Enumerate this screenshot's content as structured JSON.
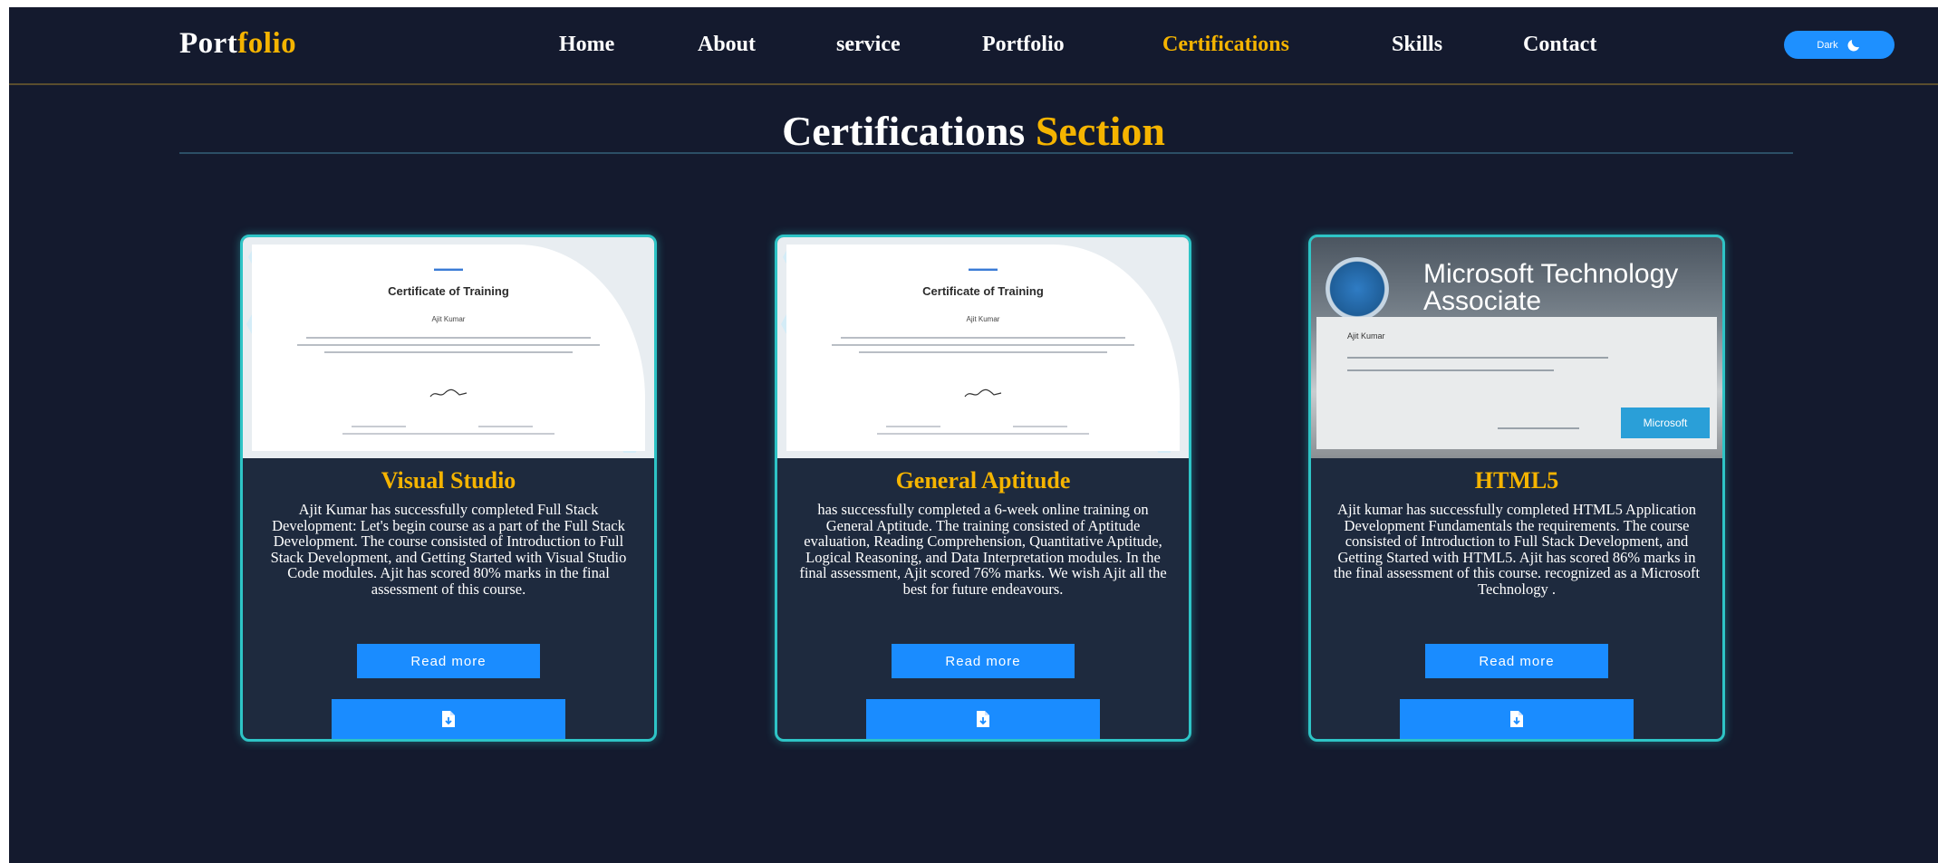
{
  "nav": {
    "logo_main": "Port",
    "logo_accent": "folio",
    "links": [
      {
        "label": "Home",
        "active": false
      },
      {
        "label": "About",
        "active": false
      },
      {
        "label": "service",
        "active": false
      },
      {
        "label": "Portfolio",
        "active": false
      },
      {
        "label": "Certifications",
        "active": true
      },
      {
        "label": "Skills",
        "active": false
      },
      {
        "label": "Contact",
        "active": false
      }
    ],
    "theme_toggle_label": "Dark",
    "theme_toggle_icon": "moon-icon"
  },
  "section": {
    "title_main": "Certifications",
    "title_accent": "Section"
  },
  "colors": {
    "accent": "#f5b400",
    "background": "#141a2e",
    "card_bg": "#1e2a3e",
    "card_border": "#2ec4c6",
    "button": "#1a8cff"
  },
  "cards": [
    {
      "title": "Visual Studio",
      "description": "Ajit Kumar has successfully completed Full Stack Development: Let's begin course as a part of the Full Stack Development. The course consisted of Introduction to Full Stack Development, and Getting Started with Visual Studio Code modules. Ajit has scored 80% marks in the final assessment of this course.",
      "read_more": "Read more",
      "certificate": {
        "heading": "Certificate of Training",
        "name": "Ajit Kumar"
      },
      "download_icon": "file-download-icon"
    },
    {
      "title": "General Aptitude",
      "description": "has successfully completed a 6-week online training on General Aptitude. The training consisted of Aptitude evaluation, Reading Comprehension, Quantitative Aptitude, Logical Reasoning, and Data Interpretation modules. In the final assessment, Ajit scored 76% marks. We wish Ajit all the best for future endeavours.",
      "read_more": "Read more",
      "certificate": {
        "heading": "Certificate of Training",
        "name": "Ajit Kumar"
      },
      "download_icon": "file-download-icon"
    },
    {
      "title": "HTML5",
      "description": "Ajit kumar has successfully completed HTML5 Application Development Fundamentals the requirements. The course consisted of Introduction to Full Stack Development, and Getting Started with HTML5. Ajit has scored 86% marks in the final assessment of this course. recognized as a Microsoft Technology .",
      "read_more": "Read more",
      "certificate": {
        "title_line1": "Microsoft Technology",
        "title_line2": "Associate",
        "name": "Ajit Kumar",
        "badge": "Microsoft"
      },
      "download_icon": "file-download-icon"
    }
  ]
}
